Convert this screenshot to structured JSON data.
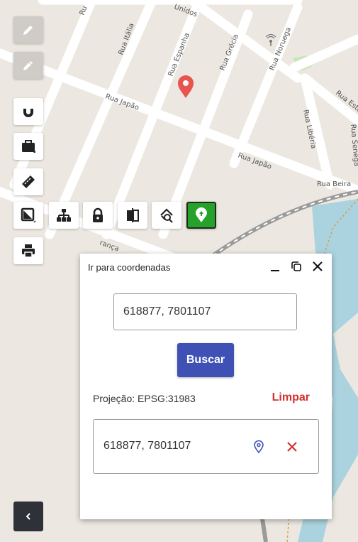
{
  "map": {
    "streets": [
      "Rua Itália",
      "Rua Espanha",
      "Rua Grécia",
      "Rua Noruega",
      "Rua Japão",
      "Rua Japão",
      "Rua Libéria",
      "Rua Beira",
      "Rua Esta",
      "Rua Senega",
      "Unidos",
      "Ru",
      "rança"
    ]
  },
  "toolbar": {
    "left_tools": [
      "pencil-icon",
      "pencil-edit-icon",
      "magnet-icon",
      "briefcase-icon",
      "ruler-icon",
      "layers-icon",
      "print-icon"
    ],
    "row_tools": [
      "hierarchy-icon",
      "lock-icon",
      "compare-icon",
      "zoom-area-icon",
      "location-pin-icon"
    ],
    "active_tool": "location-pin-icon",
    "active_color": "#25a22a"
  },
  "dialog": {
    "title": "Ir para coordenadas",
    "coordinate_value": "618877, 7801107",
    "search_label": "Buscar",
    "projection": "Projeção: EPSG:31983",
    "clear_label": "Limpar",
    "result": {
      "text": "618877, 7801107"
    },
    "accent_color": "#3f51b5",
    "danger_color": "#d32f2f"
  }
}
